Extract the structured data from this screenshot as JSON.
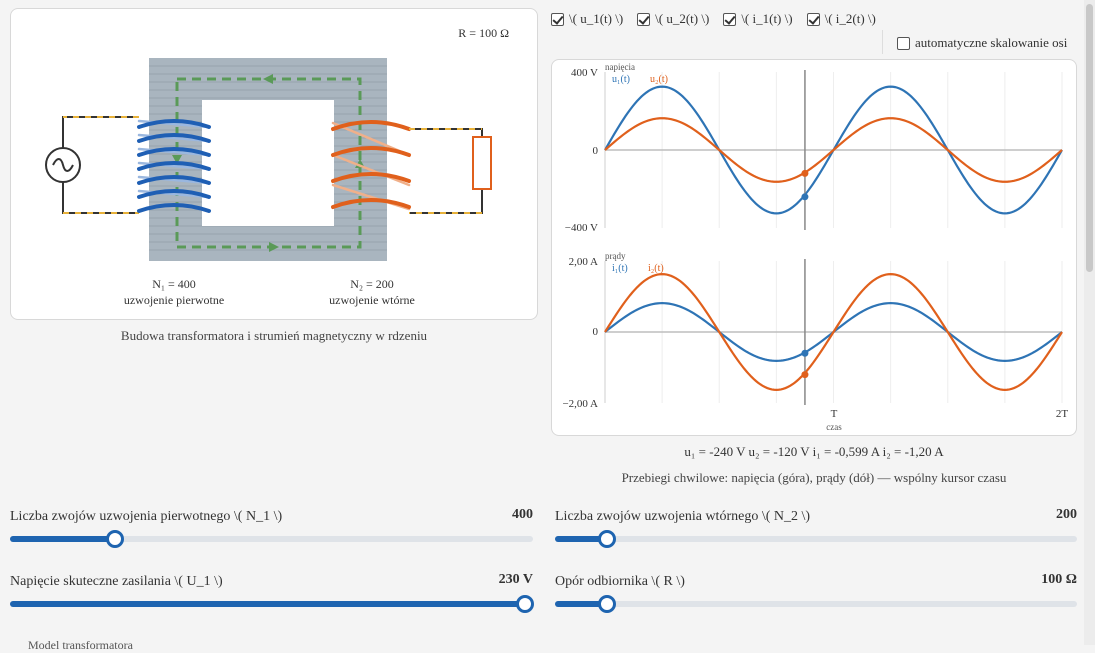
{
  "diagram": {
    "resistance_label": "R = 100 Ω",
    "primary_turns": "N₁ = 400",
    "primary_name": "uzwojenie pierwotne",
    "secondary_turns": "N₂ = 200",
    "secondary_name": "uzwojenie wtórne",
    "caption": "Budowa transformatora i strumień magnetyczny w rdzeniu"
  },
  "toggles": {
    "u1": "\\( u_1(t) \\)",
    "u2": "\\( u_2(t) \\)",
    "i1": "\\( i_1(t) \\)",
    "i2": "\\( i_2(t) \\)",
    "autoscale": "automatyczne skalowanie osi"
  },
  "plots": {
    "voltage": {
      "title": "napięcia",
      "y_top": "400 V",
      "y_mid": "0",
      "y_bottom": "−400 V",
      "legend_1": "u₁(t)",
      "legend_2": "u₂(t)"
    },
    "current": {
      "title": "prądy",
      "y_top": "2,00 A",
      "y_mid": "0",
      "y_bottom": "−2,00 A",
      "legend_1": "i₁(t)",
      "legend_2": "i₂(t)"
    },
    "x_tick_1": "T",
    "x_tick_2": "2T",
    "x_label": "czas"
  },
  "chart_data": [
    {
      "type": "line",
      "title": "",
      "xlabel": "czas",
      "ylabel": "napięcia",
      "ylim": [
        -400,
        400
      ],
      "x_period_ticks": [
        "T",
        "2T"
      ],
      "cursor_t": 0.875,
      "series": [
        {
          "name": "u₁(t)",
          "amplitude": 325,
          "color": "#2e74b5"
        },
        {
          "name": "u₂(t)",
          "amplitude": 163,
          "color": "#e0601c"
        }
      ],
      "cursor_values": {
        "u1": -240,
        "u2": -120
      }
    },
    {
      "type": "line",
      "title": "",
      "xlabel": "czas",
      "ylabel": "prądy",
      "ylim": [
        -2,
        2
      ],
      "x_period_ticks": [
        "T",
        "2T"
      ],
      "cursor_t": 0.875,
      "series": [
        {
          "name": "i₁(t)",
          "amplitude": 0.813,
          "color": "#2e74b5"
        },
        {
          "name": "i₂(t)",
          "amplitude": 1.63,
          "color": "#e0601c"
        }
      ],
      "cursor_values": {
        "i1": -0.599,
        "i2": -1.2
      }
    }
  ],
  "readout": "u₁ = -240 V u₂ = -120 V i₁ = -0,599 A i₂ = -1,20 A",
  "plots_caption": "Przebiegi chwilowe: napięcia (góra), prądy (dół) — wspólny kursor czasu",
  "sliders": {
    "n1": {
      "label": "Liczba zwojów uzwojenia pierwotnego \\( N_1 \\)",
      "value": "400",
      "fraction": 0.2
    },
    "n2": {
      "label": "Liczba zwojów uzwojenia wtórnego \\( N_2 \\)",
      "value": "200",
      "fraction": 0.1
    },
    "u1": {
      "label": "Napięcie skuteczne zasilania \\( U_1 \\)",
      "value": "230 V",
      "fraction": 1.0
    },
    "r": {
      "label": "Opór odbiornika \\( R \\)",
      "value": "100 Ω",
      "fraction": 0.1
    }
  },
  "footer_cut": "Model transformatora"
}
